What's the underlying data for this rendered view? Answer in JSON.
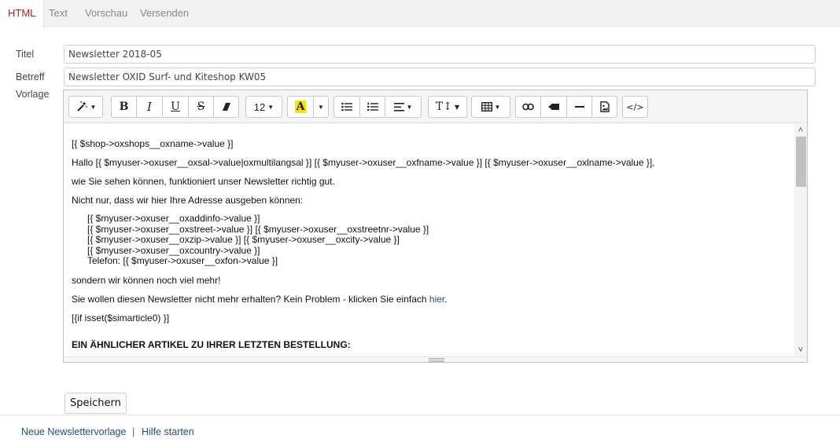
{
  "tabs": [
    {
      "label": "HTML",
      "active": true
    },
    {
      "label": "Text",
      "active": false
    },
    {
      "label": "Vorschau",
      "active": false
    },
    {
      "label": "Versenden",
      "active": false
    }
  ],
  "form": {
    "title_label": "Titel",
    "title_value": "Newsletter 2018-05",
    "subject_label": "Betreff",
    "subject_value": "Newsletter OXID Surf- und Kiteshop KW05",
    "template_label": "Vorlage"
  },
  "toolbar": {
    "font_size": "12",
    "bold": "B",
    "italic": "I",
    "underline": "U",
    "strike": "S",
    "heading": "T↕",
    "code": "</>",
    "highlight": "A"
  },
  "content": {
    "line1": "[{ $shop->oxshops__oxname->value }]",
    "line2": "Hallo [{ $myuser->oxuser__oxsal->value|oxmultilangsal }] [{ $myuser->oxuser__oxfname->value }] [{ $myuser->oxuser__oxlname->value }],",
    "line3": "wie Sie sehen können, funktioniert unser Newsletter richtig gut.",
    "line4": "Nicht nur, dass wir hier Ihre Adresse ausgeben können:",
    "address": [
      "[{ $myuser->oxuser__oxaddinfo->value }]",
      "[{ $myuser->oxuser__oxstreet->value }] [{ $myuser->oxuser__oxstreetnr->value }]",
      "[{ $myuser->oxuser__oxzip->value }] [{ $myuser->oxuser__oxcity->value }]",
      "[{ $myuser->oxuser__oxcountry->value }]",
      "Telefon: [{ $myuser->oxuser__oxfon->value }]"
    ],
    "line5": "sondern wir können noch viel mehr!",
    "line6_prefix": "Sie wollen diesen Newsletter nicht mehr erhalten? Kein Problem - klicken Sie einfach ",
    "line6_link": "hier",
    "line6_suffix": ".",
    "line7": "[{if isset($simarticle0) }]",
    "line8": "EIN ÄHNLICHER ARTIKEL ZU IHRER LETZTEN BESTELLUNG:"
  },
  "save_label": "Speichern",
  "footer": {
    "new_template": "Neue Newslettervorlage",
    "separator": "|",
    "help": "Hilfe starten"
  },
  "colors": {
    "active_tab": "#a6262a",
    "link": "#1c4e7e",
    "highlight": "#f2e600"
  }
}
